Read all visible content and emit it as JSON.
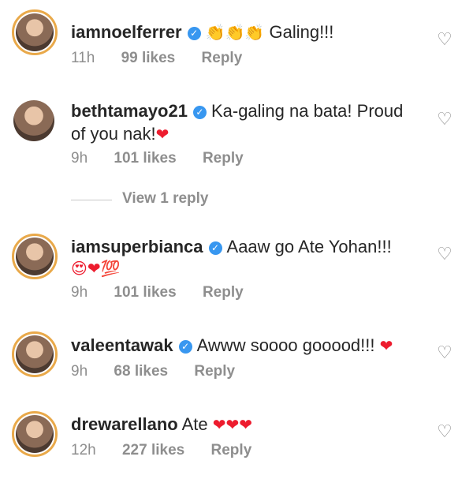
{
  "comments": [
    {
      "username": "iamnoelferrer",
      "verified": true,
      "text": "Galing!!!",
      "emoji_prefix": "👏👏👏",
      "time": "11h",
      "likes": "99 likes",
      "reply": "Reply"
    },
    {
      "username": "bethtamayo21",
      "verified": true,
      "text_line1": "Ka-galing na bata! Proud",
      "text_line2": "of you nak!",
      "emoji_suffix": "❤",
      "time": "9h",
      "likes": "101 likes",
      "reply": "Reply"
    },
    {
      "username": "iamsuperbianca",
      "verified": true,
      "text": "Aaaw go Ate Yohan!!!",
      "emoji_line2": "😍❤💯",
      "time": "9h",
      "likes": "101 likes",
      "reply": "Reply"
    },
    {
      "username": "valeentawak",
      "verified": true,
      "text": "Awww soooo gooood!!!",
      "emoji_suffix": "❤",
      "time": "9h",
      "likes": "68 likes",
      "reply": "Reply"
    },
    {
      "username": "drewarellano",
      "verified": false,
      "text": "Ate",
      "emoji_suffix": "❤❤❤",
      "time": "12h",
      "likes": "227 likes",
      "reply": "Reply"
    }
  ],
  "view_replies": "View 1 reply",
  "icons": {
    "verified": "verified-badge-icon",
    "like": "heart-outline-icon"
  },
  "colors": {
    "verified": "#3897f0",
    "heart": "#ed1c2e",
    "meta": "#8e8e8e",
    "story_ring": "#e9a94a"
  }
}
